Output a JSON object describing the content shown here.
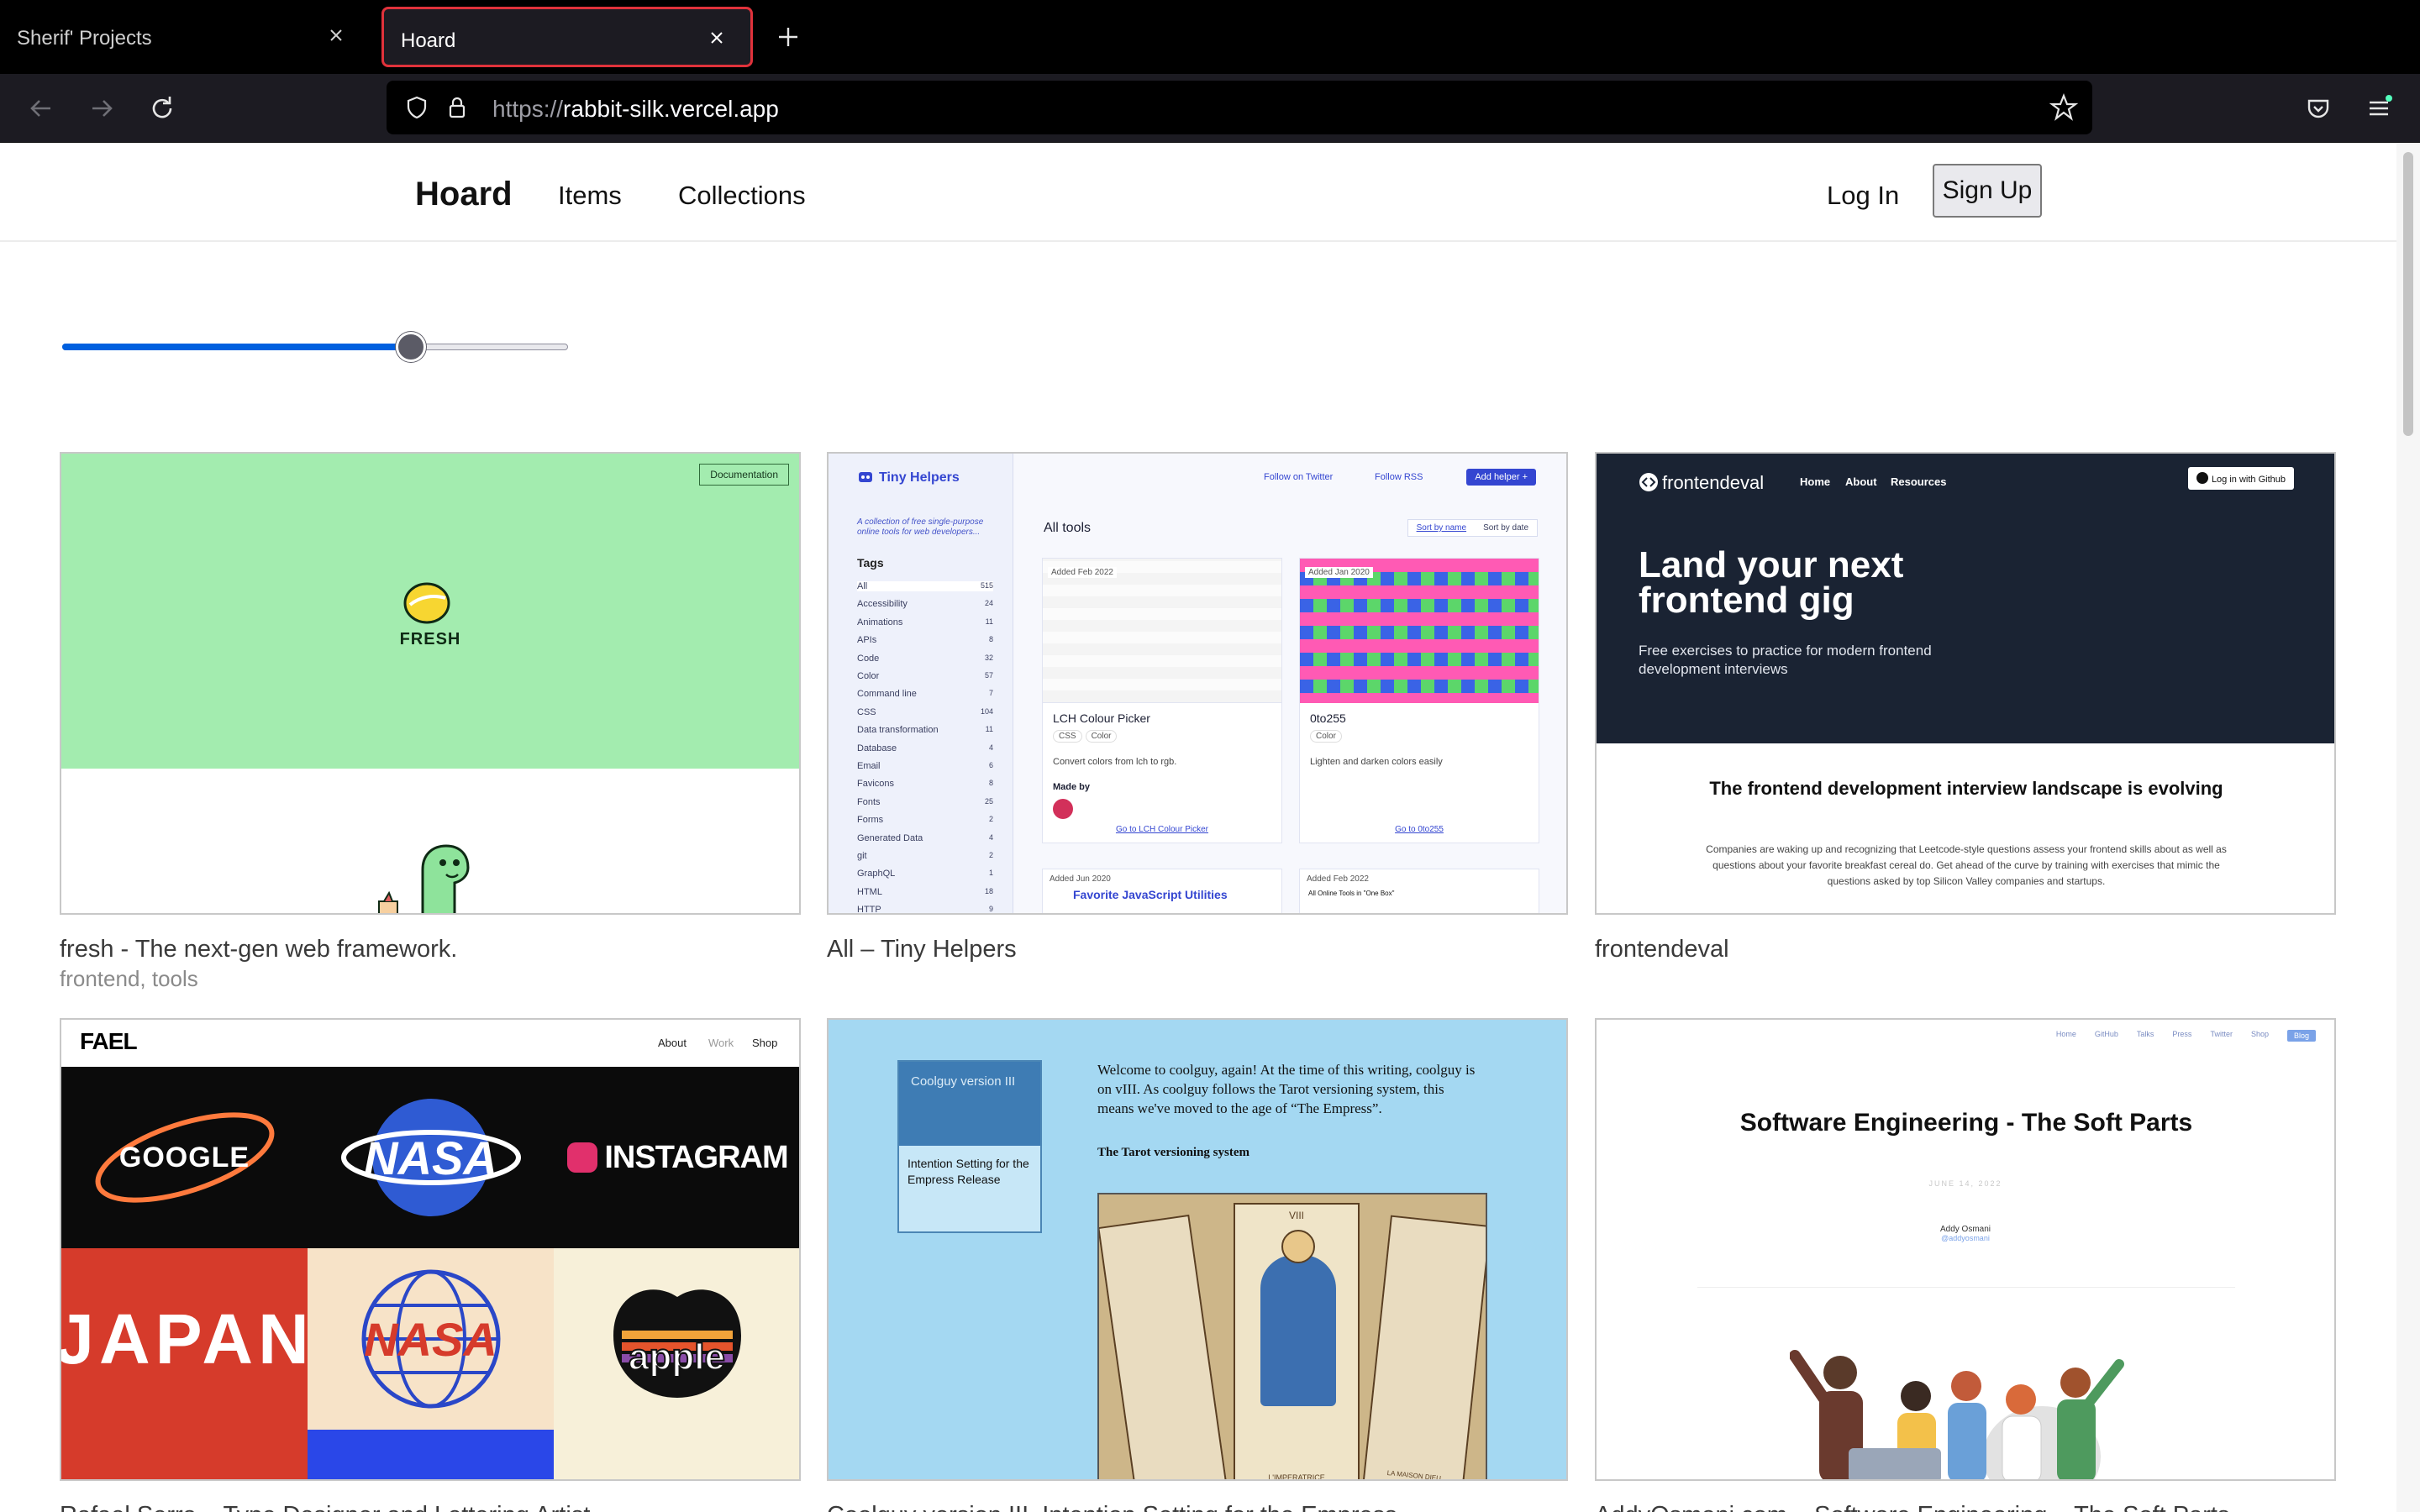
{
  "browser": {
    "tabs": [
      {
        "title": "Sherif' Projects",
        "active": false
      },
      {
        "title": "Hoard",
        "active": true
      }
    ],
    "url": {
      "protocol": "https://",
      "host": "rabbit-silk.vercel.app"
    },
    "accent_color": "#e0323b"
  },
  "site": {
    "logo": "Hoard",
    "nav": {
      "items": "Items",
      "collections": "Collections"
    },
    "login": "Log In",
    "signup": "Sign Up"
  },
  "slider": {
    "value_fraction": 0.69,
    "color": "#0060df"
  },
  "cards": [
    {
      "title": "fresh - The next-gen web framework.",
      "tags": "frontend, tools",
      "thumb": {
        "doc_button": "Documentation",
        "word": "FRESH"
      }
    },
    {
      "title": "All – Tiny Helpers",
      "tags": "",
      "thumb": {
        "logo": "Tiny Helpers",
        "tagline": "A collection of free single-purpose online tools for web developers...",
        "tags_heading": "Tags",
        "tag_list": [
          {
            "name": "All",
            "count": "515"
          },
          {
            "name": "Accessibility",
            "count": "24"
          },
          {
            "name": "Animations",
            "count": "11"
          },
          {
            "name": "APIs",
            "count": "8"
          },
          {
            "name": "Code",
            "count": "32"
          },
          {
            "name": "Color",
            "count": "57"
          },
          {
            "name": "Command line",
            "count": "7"
          },
          {
            "name": "CSS",
            "count": "104"
          },
          {
            "name": "Data transformation",
            "count": "11"
          },
          {
            "name": "Database",
            "count": "4"
          },
          {
            "name": "Email",
            "count": "6"
          },
          {
            "name": "Favicons",
            "count": "8"
          },
          {
            "name": "Fonts",
            "count": "25"
          },
          {
            "name": "Forms",
            "count": "2"
          },
          {
            "name": "Generated Data",
            "count": "4"
          },
          {
            "name": "git",
            "count": "2"
          },
          {
            "name": "GraphQL",
            "count": "1"
          },
          {
            "name": "HTML",
            "count": "18"
          },
          {
            "name": "HTTP",
            "count": "9"
          }
        ],
        "follow_twitter": "Follow on Twitter",
        "follow_rss": "Follow RSS",
        "add_helper": "Add helper +",
        "all_tools": "All tools",
        "sort_name": "Sort by name",
        "sort_date": "Sort by date",
        "tools": [
          {
            "added": "Added Feb 2022",
            "name": "LCH Colour Picker",
            "chips": [
              "CSS",
              "Color"
            ],
            "desc": "Convert colors from lch to rgb.",
            "made_by": "Made by",
            "goto": "Go to LCH Colour Picker"
          },
          {
            "added": "Added Jan 2020",
            "name": "0to255",
            "chips": [
              "Color"
            ],
            "desc": "Lighten and darken colors easily",
            "made_by": "",
            "goto": "Go to 0to255"
          }
        ],
        "next_added_1": "Added Jun 2020",
        "next_name_1": "Favorite JavaScript Utilities",
        "next_added_2": "Added Feb 2022",
        "next_name_2": "All Online Tools in \"One Box\""
      }
    },
    {
      "title": "frontendeval",
      "tags": "",
      "thumb": {
        "logo": "frontendeval",
        "links": [
          "Home",
          "About",
          "Resources"
        ],
        "github": "Log in with Github",
        "headline": "Land your next frontend gig",
        "sub": "Free exercises to practice for modern frontend development interviews",
        "h2": "The frontend development interview landscape is evolving",
        "p": "Companies are waking up and recognizing that Leetcode-style questions assess your frontend skills about as well as questions about your favorite breakfast cereal do. Get ahead of the curve by training with exercises that mimic the questions asked by top Silicon Valley companies and startups."
      }
    },
    {
      "title": "Rafael Serra – Type Designer and Lettering Artist",
      "tags": "",
      "thumb": {
        "logo": "FAEL",
        "nav": [
          "About",
          "Work",
          "Shop"
        ],
        "tiles": [
          "GOOGLE",
          "NASA",
          "INSTAGRAM",
          "JAPAN",
          "NASA",
          "apple"
        ]
      }
    },
    {
      "title": "Coolguy version III, Intention Setting for the Empress",
      "tags": "",
      "thumb": {
        "box_head": "Coolguy version III",
        "box_body": "Intention Setting for the Empress Release",
        "intro": "Welcome to coolguy, again! At the time of this writing, coolguy is on vIII. As coolguy follows the Tarot versioning system, this means we've moved to the age of “The Empress”.",
        "heading": "The Tarot versioning system",
        "card_labels": [
          "VIII",
          "L'IMPERATRICE",
          "LA MAISON DIEU"
        ]
      }
    },
    {
      "title": "AddyOsmani.com – Software Engineering – The Soft Parts",
      "tags": "",
      "thumb": {
        "nav": [
          "Home",
          "GitHub",
          "Talks",
          "Press",
          "Twitter",
          "Shop",
          "Blog"
        ],
        "title": "Software Engineering - The Soft Parts",
        "date": "JUNE 14, 2022",
        "author": "Addy Osmani",
        "handle": "@addyosmani"
      }
    }
  ]
}
